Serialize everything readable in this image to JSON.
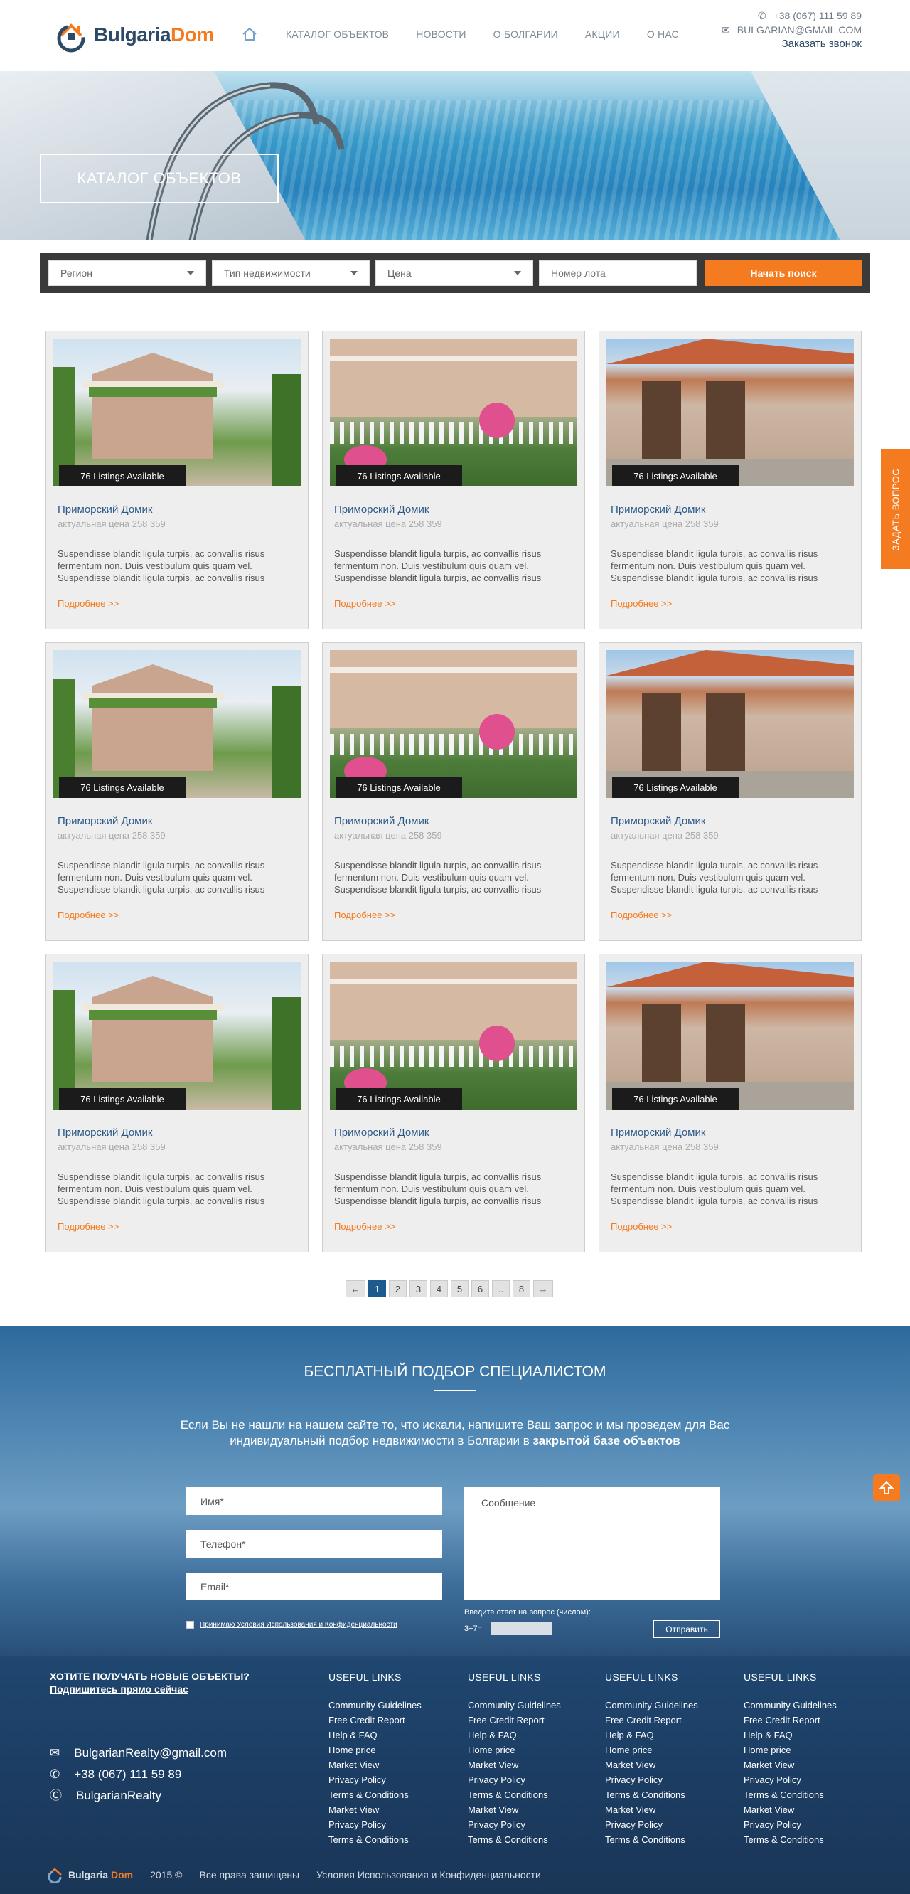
{
  "header": {
    "logo": {
      "part1": "Bulgaria",
      "part2": "Dom"
    },
    "nav": [
      "КАТАЛОГ ОБЪЕКТОВ",
      "НОВОСТИ",
      "О БОЛГАРИИ",
      "АКЦИИ",
      "О НАС"
    ],
    "phone": "+38 (067) 111 59 89",
    "email": "BULGARIAN@GMAIL.COM",
    "callback": "Заказать звонок"
  },
  "hero": {
    "title": "КАТАЛОГ ОБЪЕКТОВ"
  },
  "search": {
    "region": "Регион",
    "type": "Тип недвижимости",
    "price": "Цена",
    "lot_placeholder": "Номер лота",
    "submit": "Начать поиск"
  },
  "listings": [
    {
      "badge": "76 Listings Available",
      "title": "Приморский Домик",
      "price": "актуальная цена 258 359",
      "desc": "Suspendisse blandit ligula turpis, ac convallis risus fermentum non. Duis vestibulum quis quam vel. Suspendisse blandit ligula turpis, ac convallis risus",
      "more": "Подробнее >>"
    },
    {
      "badge": "76 Listings Available",
      "title": "Приморский Домик",
      "price": "актуальная цена 258 359",
      "desc": "Suspendisse blandit ligula turpis, ac convallis risus fermentum non. Duis vestibulum quis quam vel. Suspendisse blandit ligula turpis, ac convallis risus",
      "more": "Подробнее >>"
    },
    {
      "badge": "76 Listings Available",
      "title": "Приморский Домик",
      "price": "актуальная цена 258 359",
      "desc": "Suspendisse blandit ligula turpis, ac convallis risus fermentum non. Duis vestibulum quis quam vel. Suspendisse blandit ligula turpis, ac convallis risus",
      "more": "Подробнее >>"
    },
    {
      "badge": "76 Listings Available",
      "title": "Приморский Домик",
      "price": "актуальная цена 258 359",
      "desc": "Suspendisse blandit ligula turpis, ac convallis risus fermentum non. Duis vestibulum quis quam vel. Suspendisse blandit ligula turpis, ac convallis risus",
      "more": "Подробнее >>"
    },
    {
      "badge": "76 Listings Available",
      "title": "Приморский Домик",
      "price": "актуальная цена 258 359",
      "desc": "Suspendisse blandit ligula turpis, ac convallis risus fermentum non. Duis vestibulum quis quam vel. Suspendisse blandit ligula turpis, ac convallis risus",
      "more": "Подробнее >>"
    },
    {
      "badge": "76 Listings Available",
      "title": "Приморский Домик",
      "price": "актуальная цена 258 359",
      "desc": "Suspendisse blandit ligula turpis, ac convallis risus fermentum non. Duis vestibulum quis quam vel. Suspendisse blandit ligula turpis, ac convallis risus",
      "more": "Подробнее >>"
    },
    {
      "badge": "76 Listings Available",
      "title": "Приморский Домик",
      "price": "актуальная цена 258 359",
      "desc": "Suspendisse blandit ligula turpis, ac convallis risus fermentum non. Duis vestibulum quis quam vel. Suspendisse blandit ligula turpis, ac convallis risus",
      "more": "Подробнее >>"
    },
    {
      "badge": "76 Listings Available",
      "title": "Приморский Домик",
      "price": "актуальная цена 258 359",
      "desc": "Suspendisse blandit ligula turpis, ac convallis risus fermentum non. Duis vestibulum quis quam vel. Suspendisse blandit ligula turpis, ac convallis risus",
      "more": "Подробнее >>"
    },
    {
      "badge": "76 Listings Available",
      "title": "Приморский Домик",
      "price": "актуальная цена 258 359",
      "desc": "Suspendisse blandit ligula turpis, ac convallis risus fermentum non. Duis vestibulum quis quam vel. Suspendisse blandit ligula turpis, ac convallis risus",
      "more": "Подробнее >>"
    }
  ],
  "pagination": {
    "prev": "←",
    "pages": [
      "1",
      "2",
      "3",
      "4",
      "5",
      "6",
      "..",
      "8"
    ],
    "next": "→",
    "current": "1"
  },
  "cta": {
    "title": "БЕСПЛАТНЫЙ ПОДБОР СПЕЦИАЛИСТОМ",
    "intro_1": "Если Вы не нашли на нашем сайте то, что искали, напишите Ваш запрос и мы проведем для Вас индивидуальный подбор недвижимости в Болгарии в ",
    "intro_bold": "закрытой базе объектов",
    "name_placeholder": "Имя*",
    "phone_placeholder": "Телефон*",
    "email_placeholder": "Email*",
    "message_placeholder": "Сообщение",
    "agree": "Принимаю Условия Использования и Конфиденциальности",
    "captcha_question": "Введите ответ на вопрос (числом):",
    "captcha": "3+7=",
    "send": "Отправить"
  },
  "footer": {
    "subscribe_title": "ХОТИТЕ ПОЛУЧАТЬ НОВЫЕ ОБЪЕКТЫ?",
    "subscribe_link": "Подпишитесь прямо сейчас",
    "email": "BulgarianRealty@gmail.com",
    "phone": "+38 (067) 111 59 89",
    "skype": "BulgarianRealty",
    "columns": [
      {
        "title": "USEFUL LINKS",
        "links": [
          "Community Guidelines",
          "Free Credit Report",
          "Help & FAQ",
          "Home price",
          "Market View",
          "Privacy Policy",
          "Terms & Conditions",
          "Market View",
          "Privacy Policy",
          "Terms & Conditions"
        ]
      },
      {
        "title": "USEFUL LINKS",
        "links": [
          "Community Guidelines",
          "Free Credit Report",
          "Help & FAQ",
          "Home price",
          "Market View",
          "Privacy Policy",
          "Terms & Conditions",
          "Market View",
          "Privacy Policy",
          "Terms & Conditions"
        ]
      },
      {
        "title": "USEFUL LINKS",
        "links": [
          "Community Guidelines",
          "Free Credit Report",
          "Help & FAQ",
          "Home price",
          "Market View",
          "Privacy Policy",
          "Terms & Conditions",
          "Market View",
          "Privacy Policy",
          "Terms & Conditions"
        ]
      },
      {
        "title": "USEFUL LINKS",
        "links": [
          "Community Guidelines",
          "Free Credit Report",
          "Help & FAQ",
          "Home price",
          "Market View",
          "Privacy Policy",
          "Terms & Conditions",
          "Market View",
          "Privacy Policy",
          "Terms & Conditions"
        ]
      }
    ],
    "bottom_logo_1": "Bulgaria",
    "bottom_logo_2": "Dom",
    "year": "2015 ©",
    "rights": "Все права защищены",
    "terms": "Условия Использования и Конфиденциальности"
  },
  "side": {
    "ask": "ЗАДАТЬ ВОПРОС"
  },
  "colors": {
    "accent": "#f47b20",
    "brand": "#2c4a66",
    "link": "#2c5a88"
  }
}
